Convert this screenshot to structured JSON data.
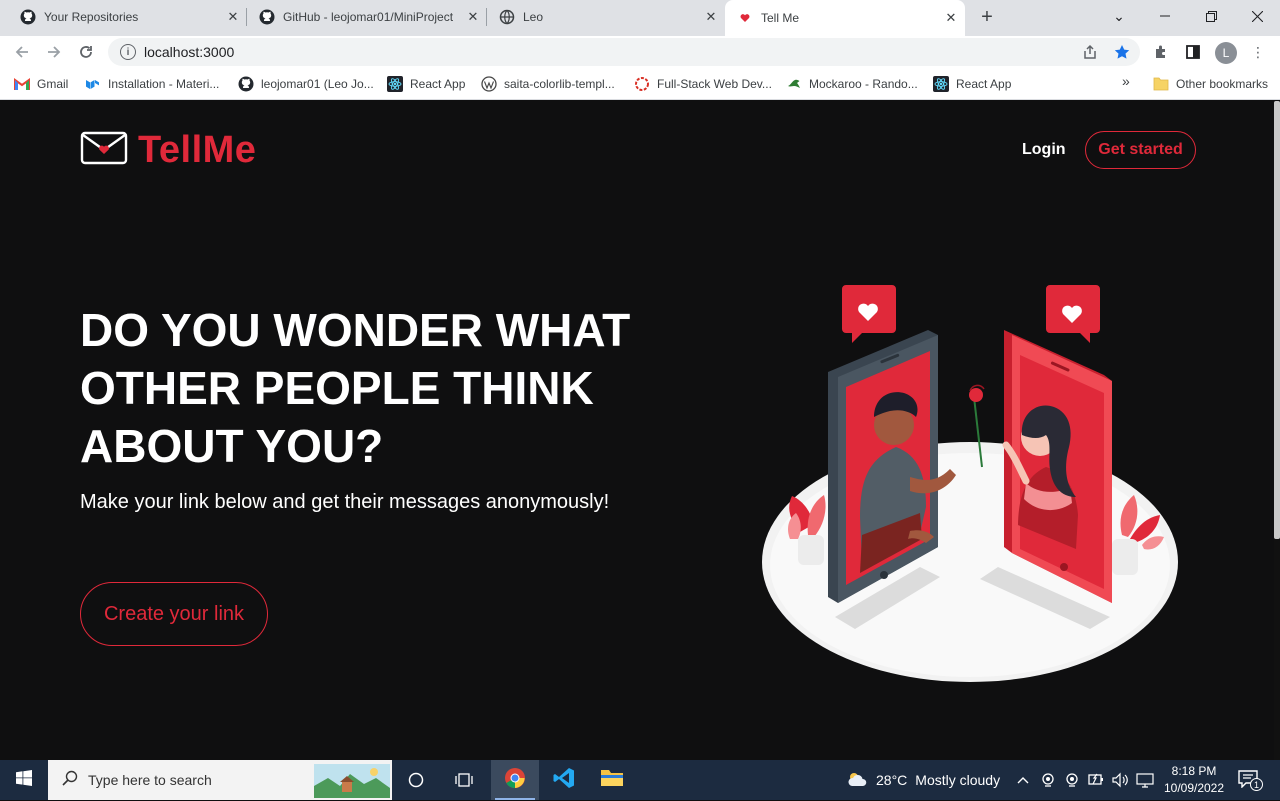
{
  "browser": {
    "tabs": [
      {
        "title": "Your Repositories",
        "icon": "github-icon"
      },
      {
        "title": "GitHub - leojomar01/MiniProject",
        "icon": "github-icon"
      },
      {
        "title": "Leo",
        "icon": "globe-icon"
      },
      {
        "title": "Tell Me",
        "icon": "heart-icon"
      }
    ],
    "url": "localhost:3000",
    "profile_initial": "L",
    "bookmarks": [
      {
        "label": "Gmail",
        "icon": "gmail-icon"
      },
      {
        "label": "Installation - Materi...",
        "icon": "mui-icon"
      },
      {
        "label": "leojomar01 (Leo Jo...",
        "icon": "github-icon"
      },
      {
        "label": "React App",
        "icon": "react-icon"
      },
      {
        "label": "saita-colorlib-templ...",
        "icon": "wordpress-icon"
      },
      {
        "label": "Full-Stack Web Dev...",
        "icon": "ring-icon"
      },
      {
        "label": "Mockaroo - Rando...",
        "icon": "mockaroo-icon"
      },
      {
        "label": "React App",
        "icon": "react-icon"
      }
    ],
    "other_bookmarks": "Other bookmarks",
    "overflow": "»"
  },
  "page": {
    "brand": "TellMe",
    "nav": {
      "login": "Login",
      "get_started": "Get started"
    },
    "headline": "DO YOU WONDER WHAT OTHER PEOPLE THINK ABOUT YOU?",
    "subline": "Make your link below and get their messages anonymously!",
    "cta": "Create your link",
    "accent": "#e0293a",
    "background": "#0f0f10"
  },
  "taskbar": {
    "search_placeholder": "Type here to search",
    "weather": {
      "temp": "28°C",
      "desc": "Mostly cloudy"
    },
    "time": "8:18 PM",
    "date": "10/09/2022",
    "notifications": "1"
  }
}
